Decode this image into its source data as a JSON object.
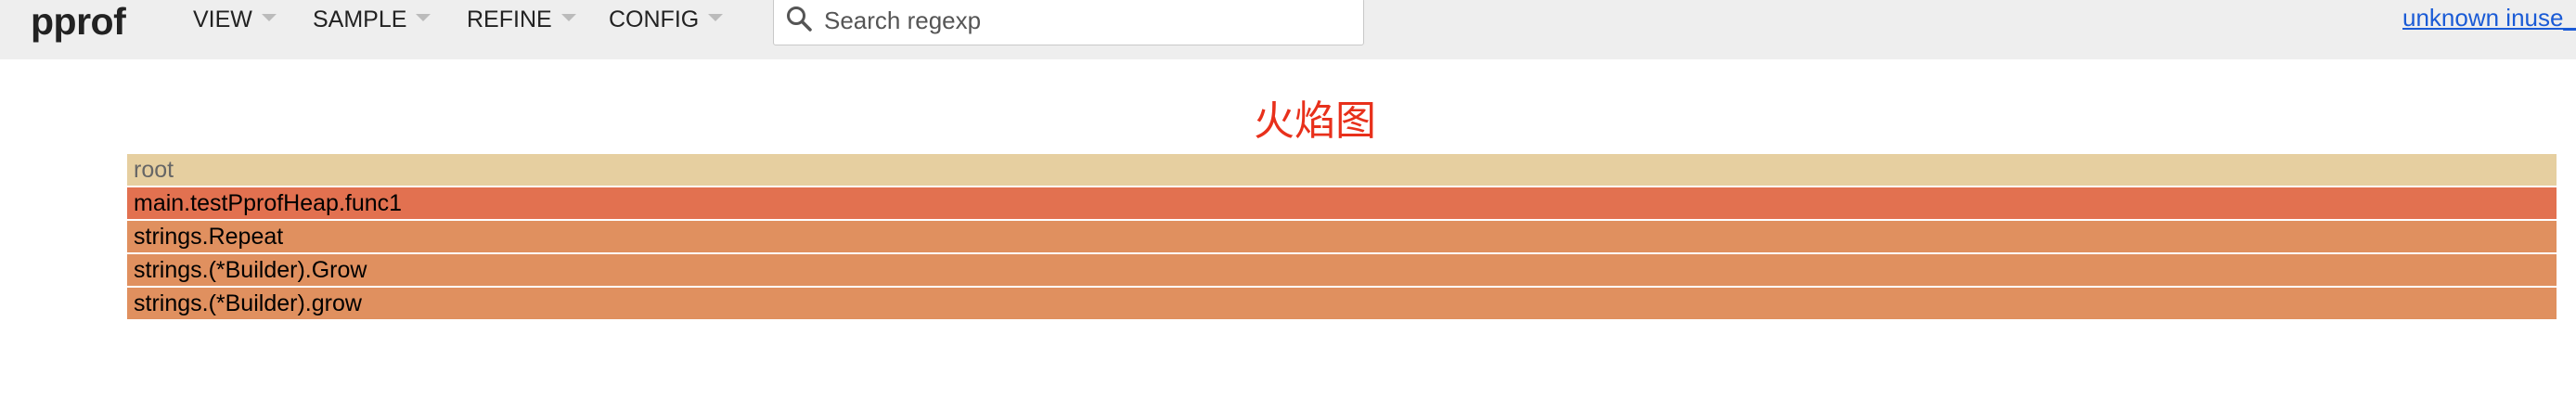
{
  "header": {
    "logo": "pprof",
    "menus": [
      {
        "label": "VIEW"
      },
      {
        "label": "SAMPLE"
      },
      {
        "label": "REFINE"
      },
      {
        "label": "CONFIG"
      }
    ],
    "search": {
      "placeholder": "Search regexp",
      "value": ""
    },
    "profile_link": "unknown inuse_"
  },
  "main": {
    "title": "火焰图",
    "frames": [
      {
        "label": "root",
        "color": "#e6cfa0",
        "text_color": "#666666"
      },
      {
        "label": "main.testPprofHeap.func1",
        "color": "#e27150"
      },
      {
        "label": "strings.Repeat",
        "color": "#e0905f"
      },
      {
        "label": "strings.(*Builder).Grow",
        "color": "#e0905f"
      },
      {
        "label": "strings.(*Builder).grow",
        "color": "#e0905f"
      }
    ]
  },
  "colors": {
    "header_bg": "#eeeeee",
    "title": "#e8301b",
    "link": "#1a5bd6"
  }
}
